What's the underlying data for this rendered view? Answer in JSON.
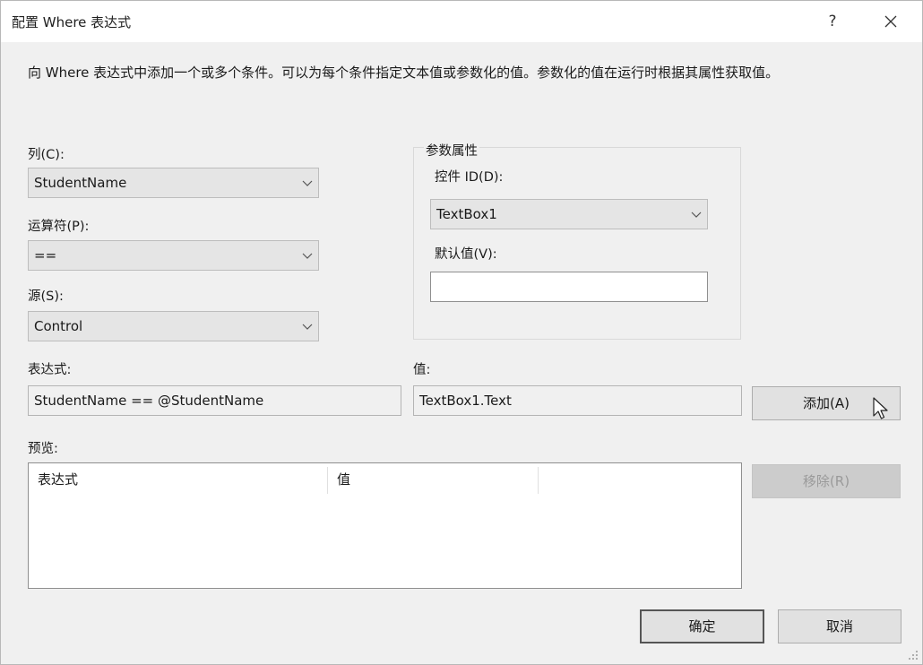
{
  "window": {
    "title": "配置 Where 表达式",
    "help_label": "?"
  },
  "description": "向 Where 表达式中添加一个或多个条件。可以为每个条件指定文本值或参数化的值。参数化的值在运行时根据其属性获取值。",
  "column": {
    "label": "列(C):",
    "value": "StudentName"
  },
  "operator": {
    "label": "运算符(P):",
    "value": "=="
  },
  "source": {
    "label": "源(S):",
    "value": "Control"
  },
  "parameter_properties": {
    "title": "参数属性",
    "control_id": {
      "label": "控件 ID(D):",
      "value": "TextBox1"
    },
    "default_value": {
      "label": "默认值(V):",
      "value": ""
    }
  },
  "expression": {
    "label": "表达式:",
    "value": "StudentName == @StudentName"
  },
  "value_field": {
    "label": "值:",
    "value": "TextBox1.Text"
  },
  "buttons": {
    "add": "添加(A)",
    "remove": "移除(R)",
    "ok": "确定",
    "cancel": "取消"
  },
  "preview": {
    "label": "预览:",
    "columns": [
      "表达式",
      "值"
    ],
    "rows": []
  },
  "icons": {
    "close": "close-icon",
    "dropdown": "chevron-down-icon",
    "cursor": "mouse-pointer-icon",
    "resize": "resize-grip-icon"
  }
}
